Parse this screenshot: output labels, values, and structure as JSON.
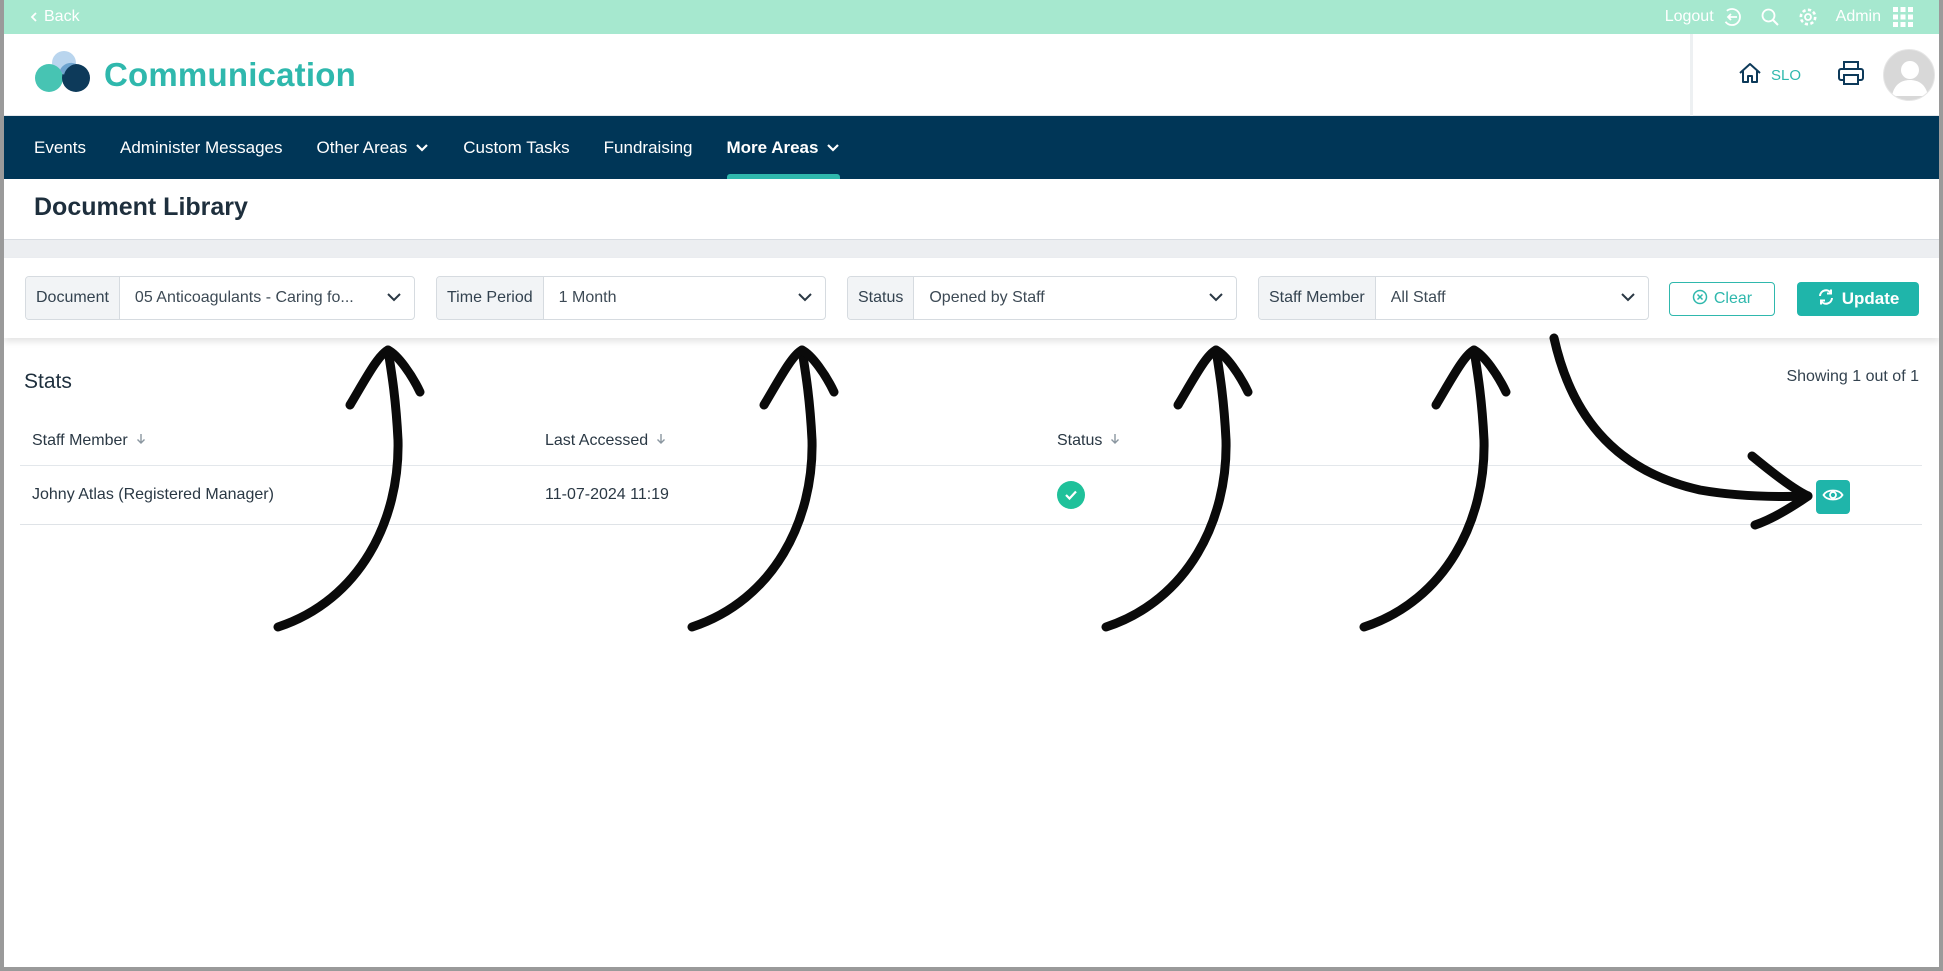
{
  "topbar": {
    "back_label": "Back",
    "logout_label": "Logout",
    "user_label": "Admin"
  },
  "header": {
    "app_title": "Communication",
    "home_label": "SLO"
  },
  "nav": {
    "items": [
      {
        "label": "Events"
      },
      {
        "label": "Administer Messages"
      },
      {
        "label": "Other Areas"
      },
      {
        "label": "Custom Tasks"
      },
      {
        "label": "Fundraising"
      },
      {
        "label": "More Areas"
      }
    ]
  },
  "page": {
    "title": "Document Library"
  },
  "filters": {
    "document": {
      "label": "Document",
      "value": "05 Anticoagulants - Caring fo..."
    },
    "time_period": {
      "label": "Time Period",
      "value": "1 Month"
    },
    "status": {
      "label": "Status",
      "value": "Opened by Staff"
    },
    "staff_member": {
      "label": "Staff Member",
      "value": "All Staff"
    },
    "clear_label": "Clear",
    "update_label": "Update"
  },
  "stats": {
    "title": "Stats",
    "showing": "Showing 1 out of 1",
    "columns": [
      "Staff Member",
      "Last Accessed",
      "Status"
    ],
    "rows": [
      {
        "staff_member": "Johny Atlas (Registered Manager)",
        "last_accessed": "11-07-2024 11:19",
        "status": "opened"
      }
    ]
  },
  "colors": {
    "accent": "#2fb8ad",
    "nav_bg": "#003657",
    "topbar_bg": "#a6e8cf",
    "status_ok": "#1fc19a"
  }
}
